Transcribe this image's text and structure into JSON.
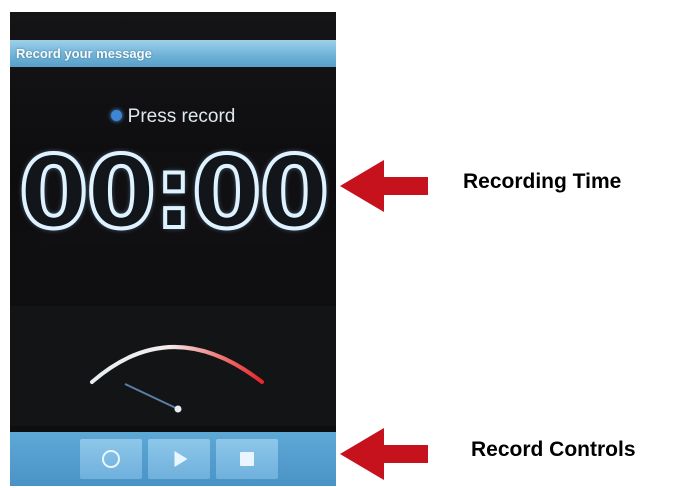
{
  "window": {
    "title": "Record your message"
  },
  "recorder": {
    "status_text": "Press record",
    "status_dot_color": "#3d86d6",
    "elapsed_time": "00:00",
    "level_meter_icon": "level-meter-gauge-icon"
  },
  "controls": {
    "record_icon": "record-icon",
    "play_icon": "play-icon",
    "stop_icon": "stop-icon",
    "accent_color": "#5ea8d6"
  },
  "annotations": {
    "recording_time": "Recording Time",
    "record_controls": "Record Controls",
    "arrow_color": "#c5121d"
  }
}
